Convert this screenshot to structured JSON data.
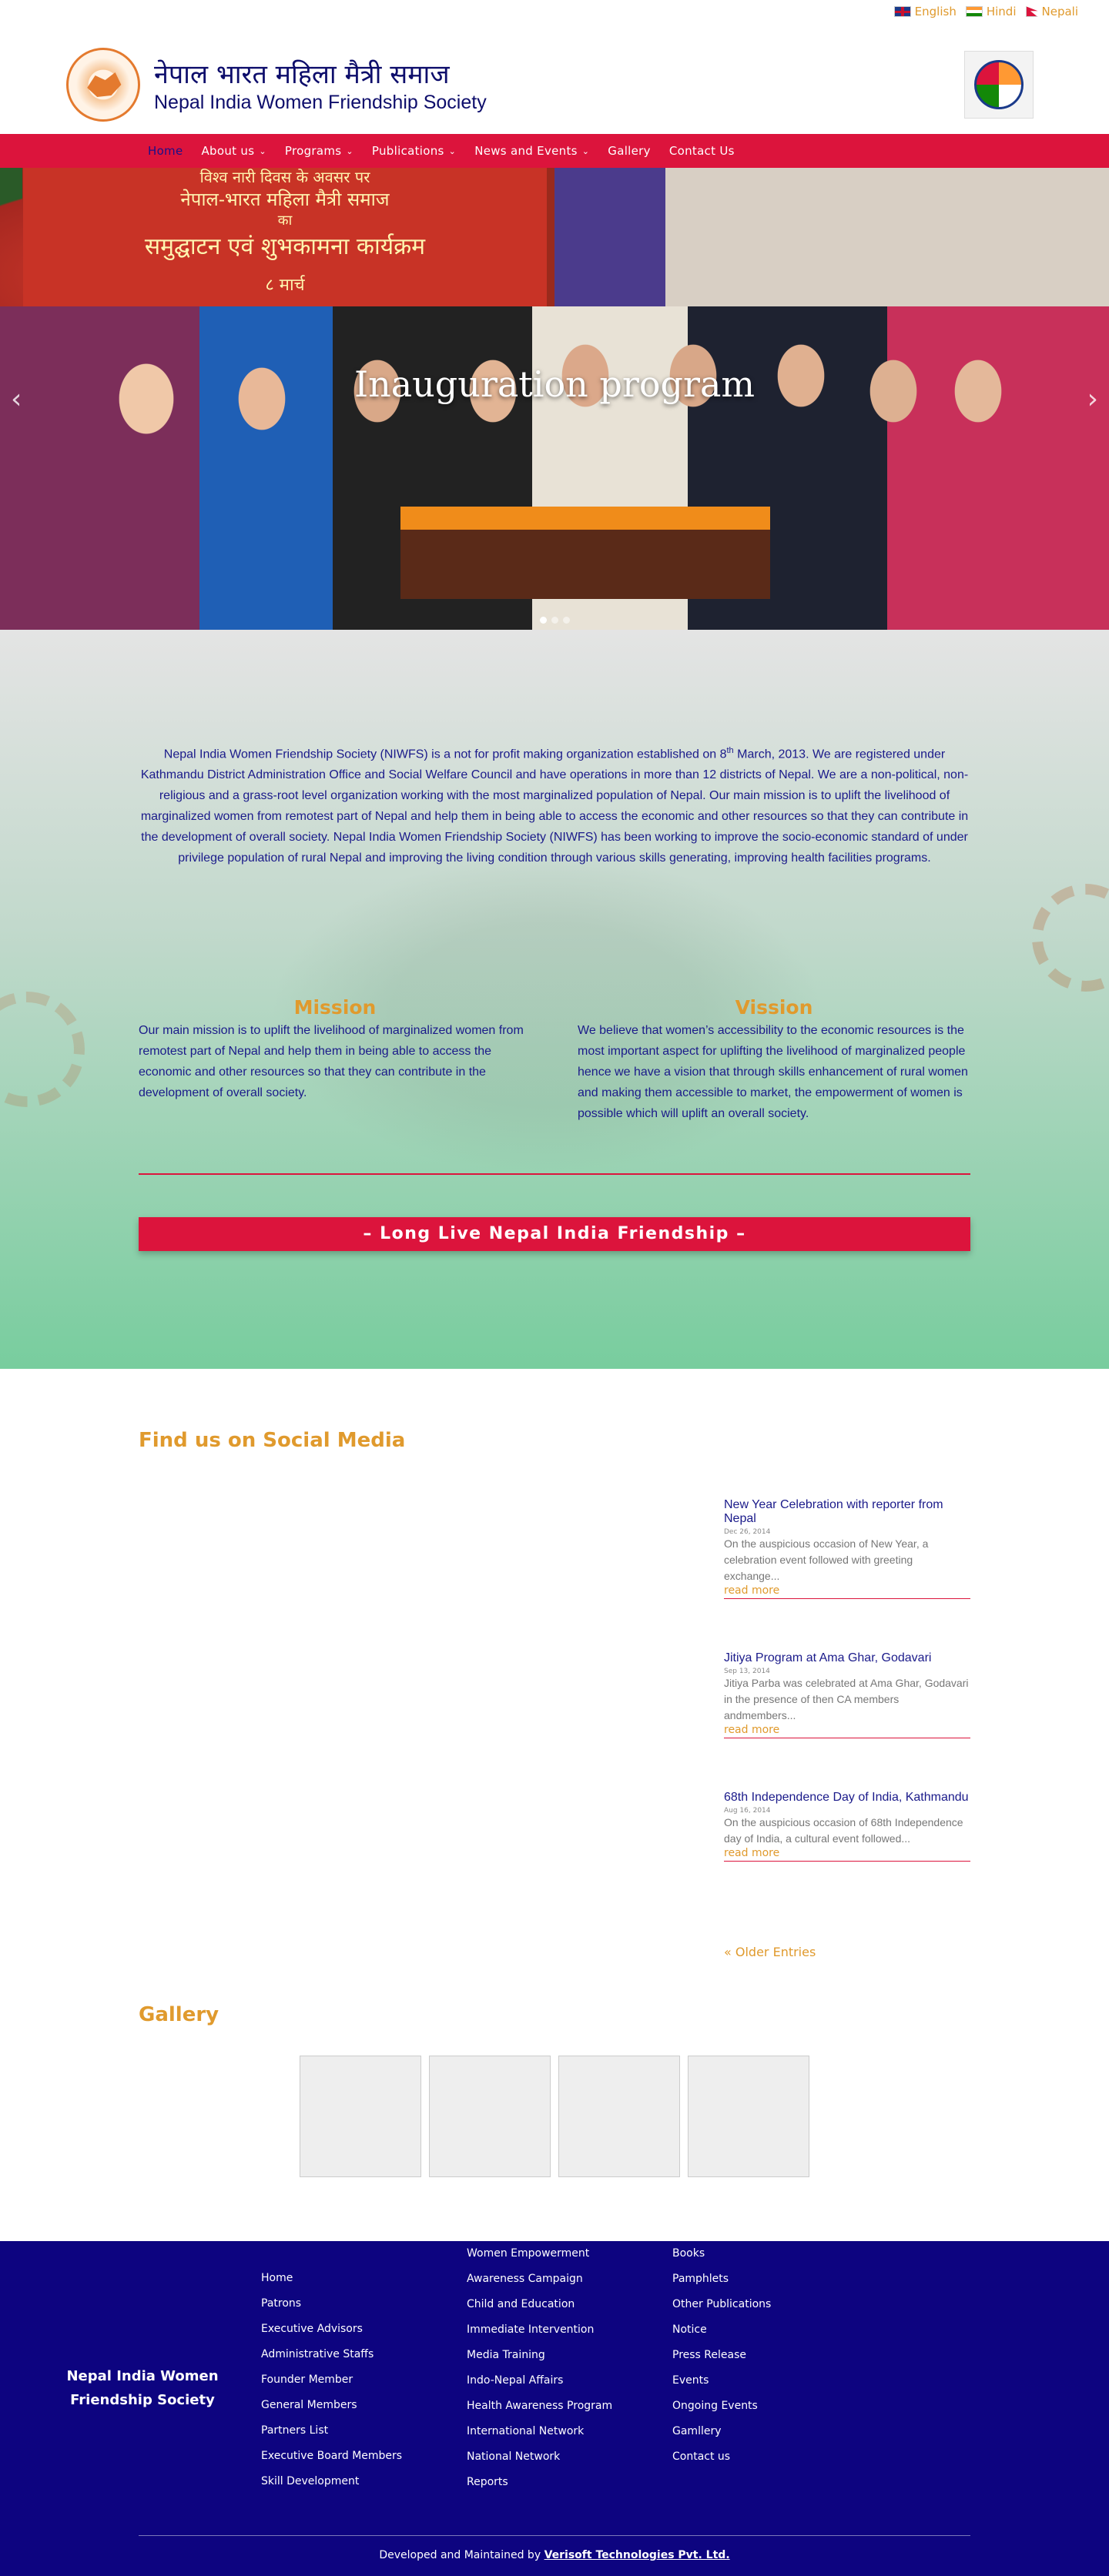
{
  "languages": [
    {
      "label": "English",
      "flag": "gb-flag-icon"
    },
    {
      "label": "Hindi",
      "flag": "in-flag-icon"
    },
    {
      "label": "Nepali",
      "flag": "np-flag-icon"
    }
  ],
  "header": {
    "title_hindi": "नेपाल भारत महिला मैत्री समाज",
    "title_english": "Nepal India Women Friendship Society"
  },
  "nav": {
    "items": [
      {
        "label": "Home",
        "dropdown": false,
        "active": true
      },
      {
        "label": "About us",
        "dropdown": true
      },
      {
        "label": "Programs",
        "dropdown": true
      },
      {
        "label": "Publications",
        "dropdown": true
      },
      {
        "label": "News and Events",
        "dropdown": true
      },
      {
        "label": "Gallery",
        "dropdown": false
      },
      {
        "label": "Contact Us",
        "dropdown": false
      }
    ]
  },
  "slider": {
    "title": "Inauguration program",
    "banner_line1": "विश्व नारी दिवस के अवसर पर",
    "banner_line2": "नेपाल-भारत महिला मैत्री समाज",
    "banner_line3": "का",
    "banner_line4": "समुद्घाटन एवं शुभकामना कार्यक्रम",
    "banner_line5": "८ मार्च"
  },
  "about": {
    "p_before": "Nepal India Women Friendship Society (NIWFS) is a not for profit making organization established on 8",
    "p_sup": "th",
    "p_after": " March, 2013. We are registered under Kathmandu District Administration Office and  Social Welfare Council and have operations in more than 12 districts of Nepal. We are a non-political, non-religious and a grass-root level organization working with the most marginalized population of Nepal. Our main mission is to uplift the livelihood of marginalized women from remotest part of Nepal and help them in being able to access the economic and other resources so that they can contribute in the development of overall society. Nepal India Women Friendship Society (NIWFS) has been working to improve the socio-economic standard of under privilege population of rural Nepal and improving the living condition through various skills generating, improving health facilities programs.",
    "mission_title": "Mission",
    "mission_text": "Our main mission is to uplift the livelihood of marginalized women from remotest part of Nepal and help them in being able to access the economic and other resources so that they can contribute in the development of overall society.",
    "vision_title": "Vission",
    "vision_text": "We believe that women’s accessibility to the economic resources is the most important aspect for uplifting the livelihood of marginalized people hence we have a vision that through skills enhancement of rural women and making them accessible to market, the empowerment of women is possible which will uplift an overall society.",
    "slogan": "– Long Live Nepal India Friendship –"
  },
  "social": {
    "heading": "Find us on Social Media"
  },
  "news": [
    {
      "title": "New Year Celebration with reporter from Nepal",
      "date": "Dec 26, 2014",
      "excerpt": "On the auspicious occasion of New Year, a celebration event followed with greeting exchange...",
      "more": "read more"
    },
    {
      "title": "Jitiya Program at Ama Ghar, Godavari",
      "date": "Sep 13, 2014",
      "excerpt": "Jitiya Parba was celebrated at Ama Ghar, Godavari in the presence of then CA members andmembers...",
      "more": "read more"
    },
    {
      "title": "68th Independence Day of India, Kathmandu",
      "date": "Aug 16, 2014",
      "excerpt": "On the auspicious occasion of 68th Independence day of India, a cultural event followed...",
      "more": "read more"
    }
  ],
  "older_entries": "« Older Entries",
  "gallery": {
    "heading": "Gallery"
  },
  "footer": {
    "brand": "Nepal India Women Friendship Society",
    "col1": [
      "Home",
      "Patrons",
      "Executive Advisors",
      "Administrative Staffs",
      "Founder Member",
      "General Members",
      "Partners List",
      "Executive Board Members",
      "Skill Development"
    ],
    "col2": [
      "Women Empowerment",
      "Awareness Campaign",
      "Child and Education",
      "Immediate Intervention",
      "Media Training",
      "Indo-Nepal Affairs",
      "Health Awareness Program",
      "International Network",
      "National Network",
      "Reports"
    ],
    "col3": [
      "Books",
      "Pamphlets",
      "Other Publications",
      "Notice",
      "Press Release",
      "Events",
      "Ongoing Events",
      "Gamllery",
      "Contact us"
    ],
    "credit_prefix": "Developed and Maintained by ",
    "credit_link": "Verisoft Technologies Pvt. Ltd."
  },
  "colors": {
    "accent_red": "#dc143c",
    "brand_blue": "#0d0480",
    "orange": "#e09a2d"
  }
}
